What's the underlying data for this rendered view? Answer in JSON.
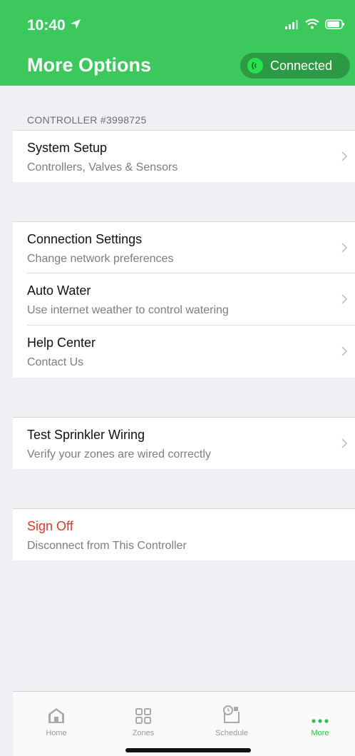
{
  "status_bar": {
    "time": "10:40"
  },
  "header": {
    "title": "More Options",
    "connection_status": "Connected"
  },
  "sections": {
    "controller_label": "CONTROLLER #3998725",
    "system_setup": {
      "title": "System Setup",
      "subtitle": "Controllers, Valves & Sensors"
    },
    "connection_settings": {
      "title": "Connection Settings",
      "subtitle": "Change network preferences"
    },
    "auto_water": {
      "title": "Auto Water",
      "subtitle": "Use internet weather to control watering"
    },
    "help_center": {
      "title": "Help Center",
      "subtitle": "Contact Us"
    },
    "test_wiring": {
      "title": "Test Sprinkler Wiring",
      "subtitle": "Verify your zones are wired correctly"
    },
    "sign_off": {
      "title": "Sign Off",
      "subtitle": "Disconnect from This Controller"
    }
  },
  "tabbar": {
    "home": "Home",
    "zones": "Zones",
    "schedule": "Schedule",
    "more": "More"
  },
  "colors": {
    "brand_green": "#3cc85c",
    "connected_dot": "#27e24d",
    "danger": "#d63a2a",
    "active_tab": "#2fbd4f"
  }
}
